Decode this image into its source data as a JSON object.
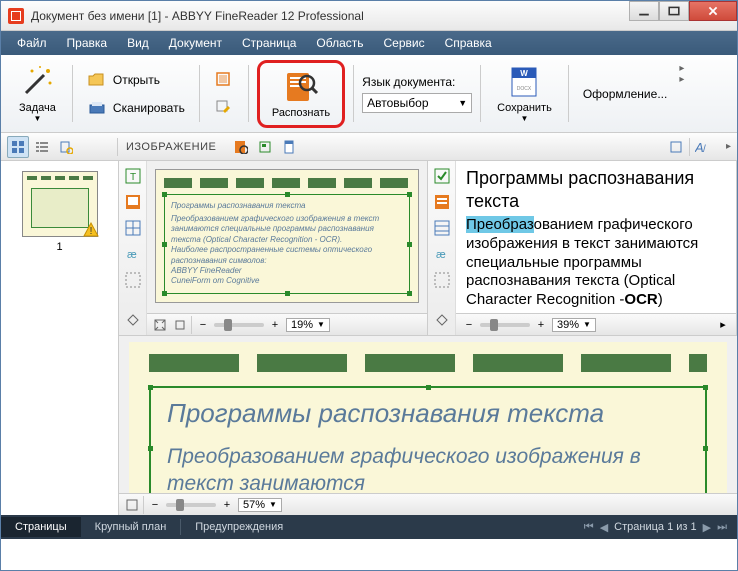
{
  "window": {
    "title": "Документ без имени [1] - ABBYY FineReader 12 Professional"
  },
  "menu": {
    "file": "Файл",
    "edit": "Правка",
    "view": "Вид",
    "document": "Документ",
    "page": "Страница",
    "area": "Область",
    "service": "Сервис",
    "help": "Справка"
  },
  "toolbar": {
    "task": "Задача",
    "open": "Открыть",
    "scan": "Сканировать",
    "recognize": "Распознать",
    "lang_label": "Язык документа:",
    "lang_value": "Автовыбор",
    "save": "Сохранить",
    "design": "Оформление..."
  },
  "viewbar": {
    "image_label": "ИЗОБРАЖЕНИЕ"
  },
  "thumbs": {
    "page1_label": "1"
  },
  "imagepane": {
    "title": "Программы распознавания текста",
    "body1": "Преобразованием графического изображения в текст занимаются специальные программы распознавания текста (Optical Character Recognition - OCR).",
    "body2": "Наиболее распространенные системы оптического распознавания символов:",
    "li1": "ABBYY FineReader",
    "li2": "CuneiForm от Cognitive",
    "zoom": "19%"
  },
  "textpane": {
    "title": "Программы распознавания текста",
    "body": "ованием графического изображения в текст занимаются специальные программы распознавания текста (Optical Character Recognition -",
    "hl": "Преобраз",
    "ocr": "OCR",
    "zoom": "39%"
  },
  "bigview": {
    "title": "Программы распознавания текста",
    "body": "Преобразованием графического изображения в текст занимаются",
    "zoom": "57%"
  },
  "status": {
    "pages": "Страницы",
    "closeup": "Крупный план",
    "warnings": "Предупреждения",
    "pageinfo": "Страница 1 из 1"
  }
}
